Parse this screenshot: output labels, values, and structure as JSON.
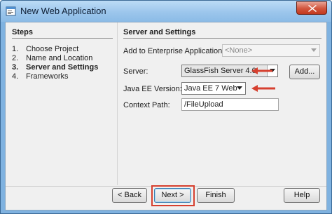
{
  "window": {
    "title": "New Web Application"
  },
  "steps": {
    "title": "Steps",
    "items": [
      {
        "num": "1.",
        "label": "Choose Project"
      },
      {
        "num": "2.",
        "label": "Name and Location"
      },
      {
        "num": "3.",
        "label": "Server and Settings"
      },
      {
        "num": "4.",
        "label": "Frameworks"
      }
    ],
    "current_index": 2
  },
  "content": {
    "title": "Server and Settings",
    "enterprise_label": "Add to Enterprise Application:",
    "enterprise_value": "<None>",
    "server_label": "Server:",
    "server_value": "GlassFish Server 4.0",
    "add_button": "Add...",
    "javaee_label": "Java EE Version:",
    "javaee_value": "Java EE 7 Web",
    "context_label": "Context Path:",
    "context_value": "/FileUpload"
  },
  "buttons": {
    "back": "< Back",
    "next": "Next >",
    "finish": "Finish",
    "help": "Help"
  },
  "colors": {
    "annotation": "#d6402f",
    "title_bar": "#9cc6ec",
    "close_button": "#d1543c"
  },
  "icons": {
    "app": "netbeans-app-icon",
    "close": "close-icon",
    "dropdown": "chevron-down-icon",
    "annotation_arrow": "arrow-left-icon"
  }
}
